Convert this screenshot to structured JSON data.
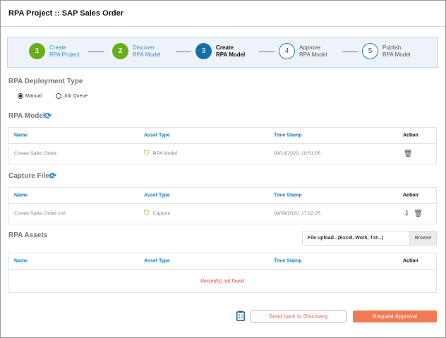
{
  "header": {
    "title": "RPA Project :: SAP Sales Order"
  },
  "stepper": {
    "steps": [
      {
        "num": "1",
        "line1": "Create",
        "line2": "RPA Project",
        "state": "done"
      },
      {
        "num": "2",
        "line1": "Discover",
        "line2": "RPA Model",
        "state": "done"
      },
      {
        "num": "3",
        "line1": "Create",
        "line2": "RPA Model",
        "state": "current"
      },
      {
        "num": "4",
        "line1": "Approve",
        "line2": "RPA Model",
        "state": "todo"
      },
      {
        "num": "5",
        "line1": "Publish",
        "line2": "RPA Model",
        "state": "todo"
      }
    ]
  },
  "deployment": {
    "heading": "RPA Deployment Type",
    "options": [
      "Manual",
      "Job Queue"
    ],
    "selected": "Manual"
  },
  "columns": {
    "name": "Name",
    "asset_type": "Asset Type",
    "time_stamp": "Time Stamp",
    "action": "Action"
  },
  "rpa_model": {
    "heading": "RPA Model",
    "rows": [
      {
        "name": "Create Sales Order",
        "asset_type": "RPA Model",
        "time_stamp": "09/14/2020, 10:51:05"
      }
    ]
  },
  "capture_files": {
    "heading": "Capture Files",
    "rows": [
      {
        "name": "Create Sales Order.xml",
        "asset_type": "Capture",
        "time_stamp": "09/09/2020, 17:02:25"
      }
    ]
  },
  "rpa_assets": {
    "heading": "RPA Assets",
    "upload_placeholder": "File upload...(Excel, Work, Txt...)",
    "browse": "Browse",
    "empty": "Record(s) not found"
  },
  "footer": {
    "send_back": "Send back to Discovery",
    "request": "Request Approval"
  },
  "colors": {
    "done": "#6aad1b",
    "current": "#1471a8",
    "accent": "#f27a52",
    "link": "#1a7fc0"
  }
}
